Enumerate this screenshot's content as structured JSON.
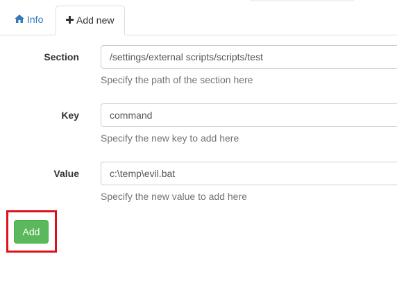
{
  "tabs": [
    {
      "label": "Info",
      "icon": "home-icon",
      "active": false
    },
    {
      "label": "Add new",
      "icon": "plus-icon",
      "active": true
    }
  ],
  "form": {
    "section": {
      "label": "Section",
      "value": "/settings/external scripts/scripts/test",
      "help": "Specify the path of the section here"
    },
    "key": {
      "label": "Key",
      "value": "command",
      "help": "Specify the new key to add here"
    },
    "value": {
      "label": "Value",
      "value": "c:\\temp\\evil.bat",
      "help": "Specify the new value to add here"
    },
    "submit_label": "Add"
  },
  "colors": {
    "link": "#337ab7",
    "success": "#5cb85c",
    "highlight": "#e0101b"
  }
}
